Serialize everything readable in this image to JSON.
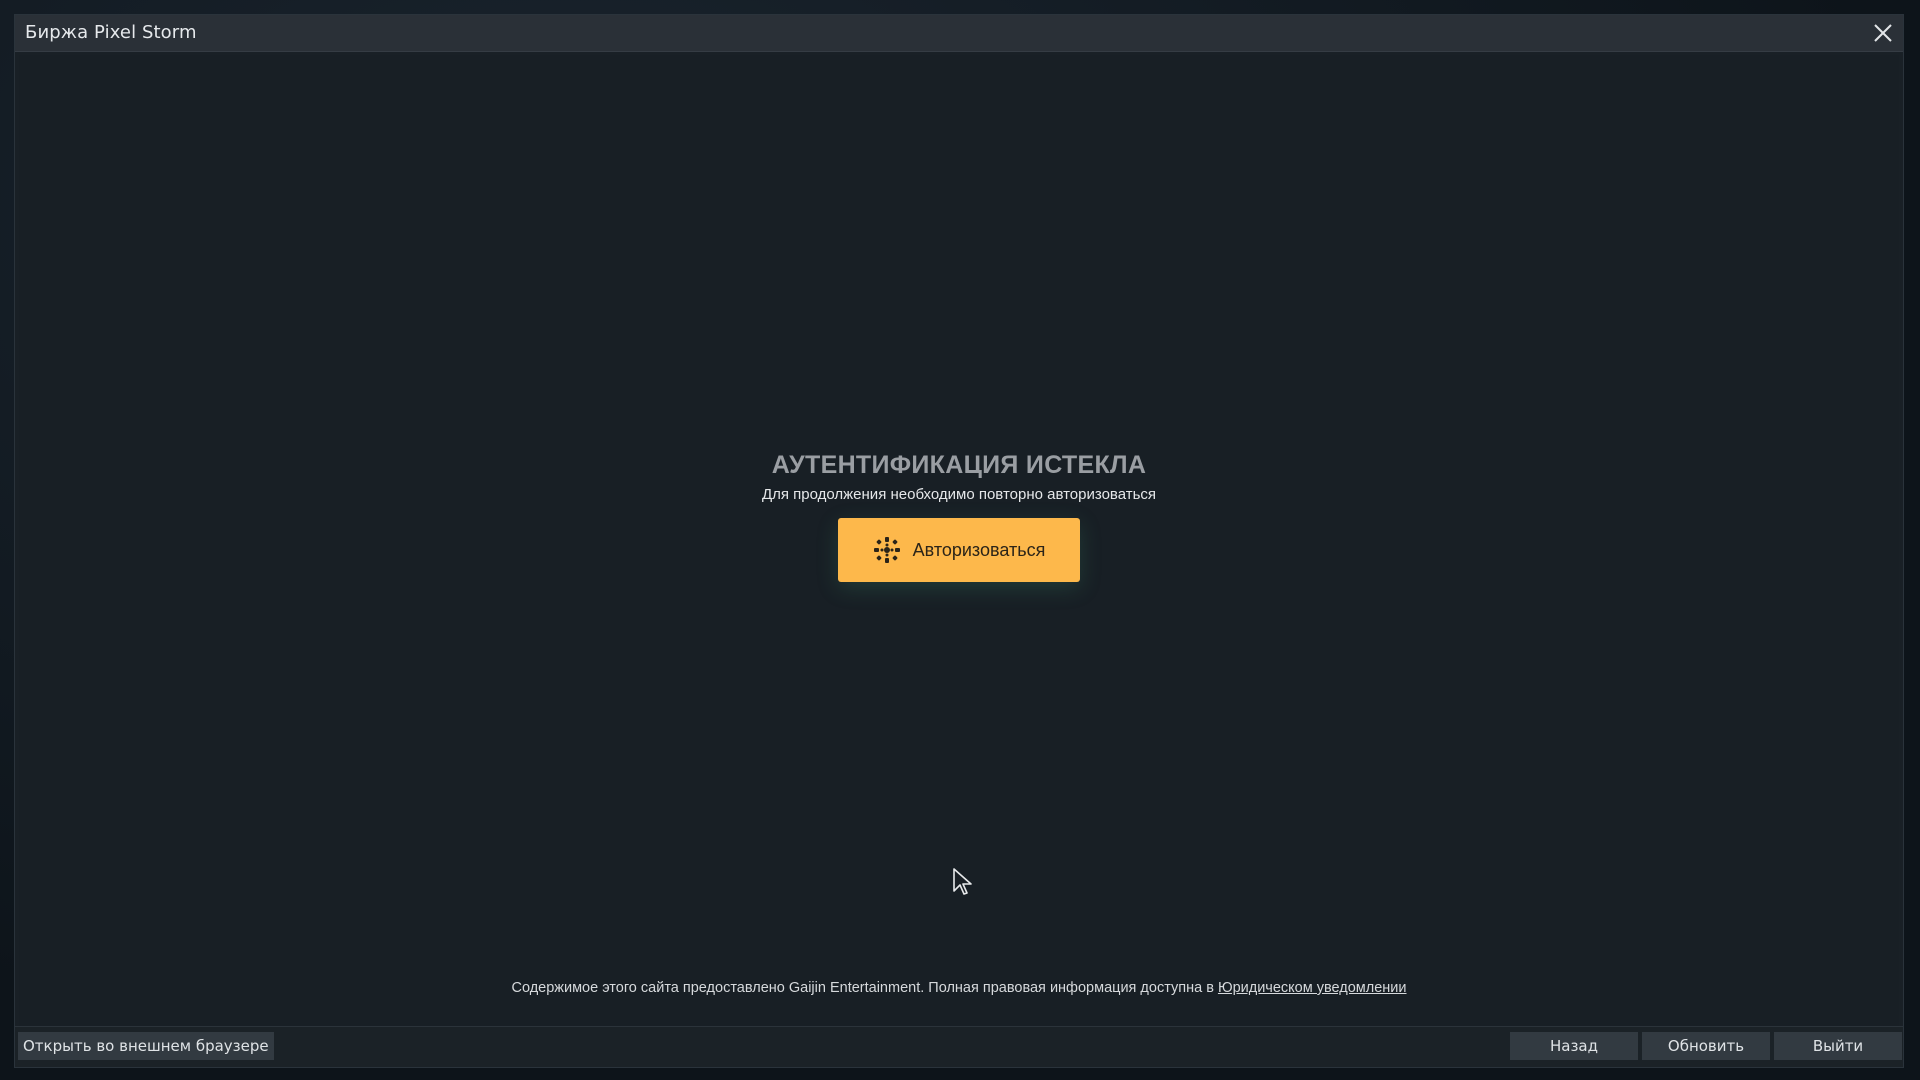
{
  "window": {
    "title": "Биржа Pixel Storm"
  },
  "auth": {
    "title": "АУТЕНТИФИКАЦИЯ ИСТЕКЛА",
    "subtitle": "Для продолжения необходимо повторно авторизоваться",
    "button_label": "Авторизоваться",
    "button_icon": "gaijin-logo-icon"
  },
  "legal": {
    "text": "Содержимое этого сайта предоставлено Gaijin Entertainment. Полная правовая информация доступна в ",
    "link": "Юридическом уведомлении"
  },
  "bottom_bar": {
    "open_external": "Открыть во внешнем браузере",
    "back": "Назад",
    "refresh": "Обновить",
    "exit": "Выйти"
  },
  "colors": {
    "accent_button": "#fdb84b",
    "background": "#181f25",
    "titlebar": "#2a3037"
  }
}
